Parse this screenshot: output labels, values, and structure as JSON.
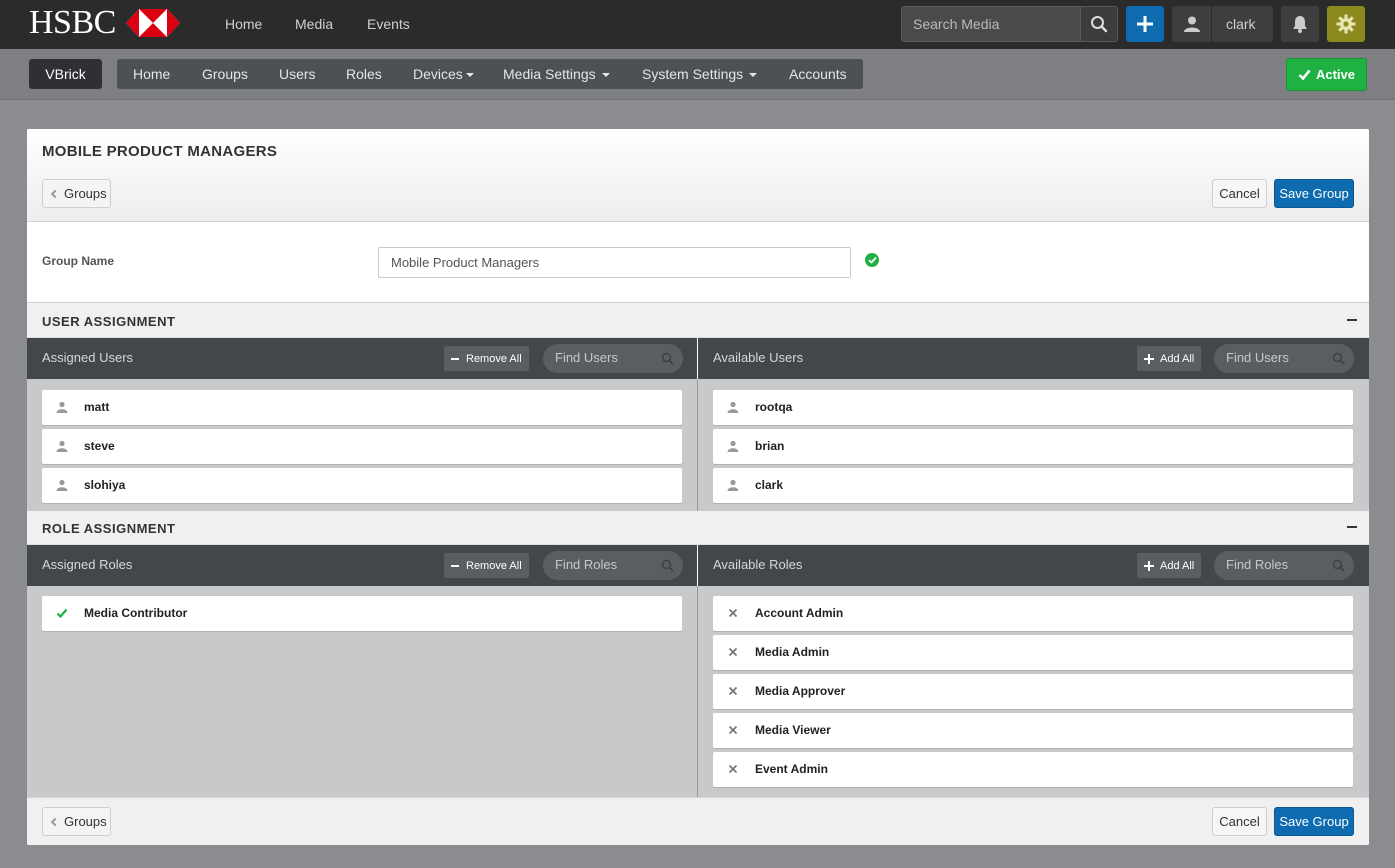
{
  "brand": {
    "logo_text": "HSBC"
  },
  "topnav": {
    "links": [
      "Home",
      "Media",
      "Events"
    ],
    "search_placeholder": "Search Media",
    "user_name": "clark"
  },
  "adminbar": {
    "account_label": "VBrick",
    "nav": [
      {
        "label": "Home"
      },
      {
        "label": "Groups"
      },
      {
        "label": "Users"
      },
      {
        "label": "Roles"
      },
      {
        "label": "Devices"
      },
      {
        "label": "Media Settings"
      },
      {
        "label": "System Settings"
      },
      {
        "label": "Accounts"
      }
    ],
    "status_label": "Active"
  },
  "page": {
    "title": "MOBILE PRODUCT MANAGERS",
    "back_label": "Groups",
    "cancel_label": "Cancel",
    "save_label": "Save Group"
  },
  "group_name": {
    "label": "Group Name",
    "value": "Mobile Product Managers"
  },
  "user_assignment": {
    "title": "USER ASSIGNMENT",
    "assigned_title": "Assigned Users",
    "available_title": "Available Users",
    "remove_all_label": "Remove All",
    "add_all_label": "Add All",
    "find_placeholder": "Find Users",
    "assigned": [
      "matt",
      "steve",
      "slohiya"
    ],
    "available": [
      "rootqa",
      "brian",
      "clark"
    ]
  },
  "role_assignment": {
    "title": "ROLE ASSIGNMENT",
    "assigned_title": "Assigned Roles",
    "available_title": "Available Roles",
    "remove_all_label": "Remove All",
    "add_all_label": "Add All",
    "find_placeholder": "Find Roles",
    "assigned": [
      "Media Contributor"
    ],
    "available": [
      "Account Admin",
      "Media Admin",
      "Media Approver",
      "Media Viewer",
      "Event Admin"
    ]
  },
  "colors": {
    "primary": "#0e6bb0",
    "success": "#1fb142",
    "nav_bg": "#2b2b2b",
    "gear_bg": "#8c8a1f"
  }
}
